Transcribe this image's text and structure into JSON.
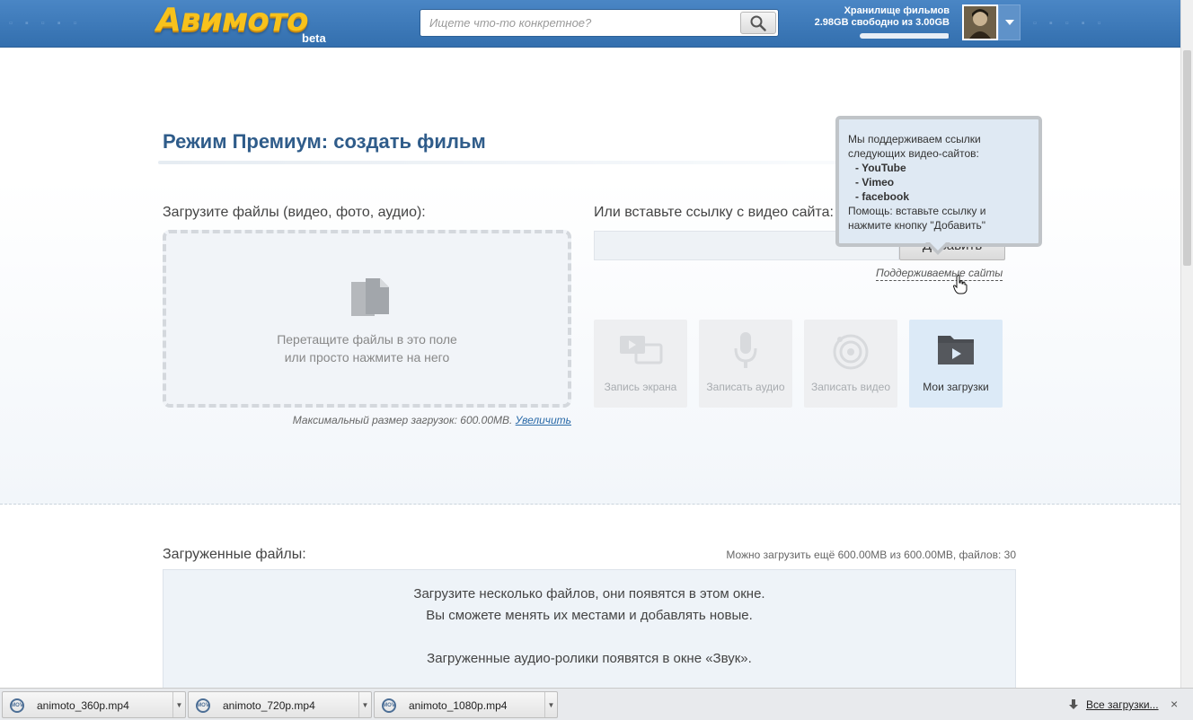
{
  "header": {
    "logo_text": "Авимото",
    "logo_badge": "beta",
    "search_placeholder": "Ищете что-то конкретное?",
    "storage_title": "Хранилище фильмов",
    "storage_detail": "2.98GB свободно из 3.00GB",
    "storage_free_fraction": 0.993
  },
  "main": {
    "title": "Режим Премиум: создать фильм",
    "upload_label": "Загрузите файлы (видео, фото, аудио):",
    "dropzone_line1": "Перетащите файлы в это поле",
    "dropzone_line2": "или просто нажмите на него",
    "max_size_text": "Максимальный размер загрузок: 600.00MB.",
    "max_size_link": "Увеличить",
    "link_label": "Или вставьте ссылку с видео сайта:",
    "add_button": "Добавить",
    "supported_sites_link": "Поддерживаемые сайты",
    "tiles": [
      {
        "label": "Запись экрана"
      },
      {
        "label": "Записать аудио"
      },
      {
        "label": "Записать видео"
      },
      {
        "label": "Мои загрузки"
      }
    ]
  },
  "tooltip": {
    "line1": "Мы поддерживаем ссылки",
    "line2": "следующих видео-сайтов:",
    "sites": [
      "- YouTube",
      "- Vimeo",
      "- facebook"
    ],
    "help1": "Помощь: вставьте ссылку и",
    "help2": "нажмите кнопку \"Добавить\""
  },
  "uploaded": {
    "label": "Загруженные файлы:",
    "quota": "Можно загрузить ещё 600.00MB из 600.00MB, файлов: 30",
    "line1": "Загрузите несколько файлов, они появятся в этом окне.",
    "line2": "Вы сможете менять их местами и добавлять новые.",
    "line3": "Загруженные аудио-ролики появятся в окне «Звук»."
  },
  "downloads": {
    "items": [
      {
        "name": "animoto_360p.mp4"
      },
      {
        "name": "animoto_720p.mp4"
      },
      {
        "name": "animoto_1080p.mp4"
      }
    ],
    "icon_text": "MOV",
    "all_link": "Все загрузки...",
    "close": "×"
  },
  "colors": {
    "header_blue": "#3c78b9",
    "title_blue": "#2f5c8a",
    "logo_yellow": "#f7c21c"
  }
}
